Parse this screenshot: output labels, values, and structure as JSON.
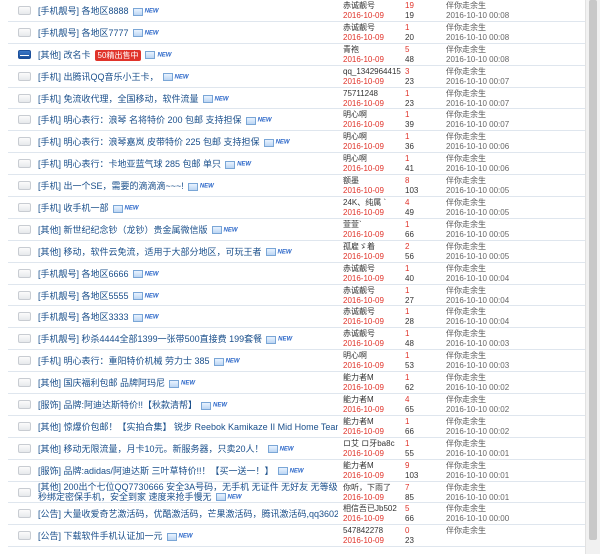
{
  "rows": [
    {
      "cat": "[手机靓号]",
      "title": "各地区8888",
      "new": "NEW",
      "author": "赤诚靓号",
      "date": "2016-10-09",
      "r": "19",
      "v": "19",
      "lu": "伴你走余生",
      "lt": "2016-10-10 00:08"
    },
    {
      "cat": "[手机靓号]",
      "title": "各地区7777",
      "new": "NEW",
      "author": "赤诚靓号",
      "date": "2016-10-09",
      "r": "1",
      "v": "20",
      "lu": "伴你走余生",
      "lt": "2016-10-10 00:08"
    },
    {
      "cat": "[其他]",
      "title": "改名卡",
      "badge": "50精出售中",
      "new": "NEW",
      "author": "青袍",
      "date": "2016-10-09",
      "r": "5",
      "v": "48",
      "lu": "伴你走余生",
      "lt": "2016-10-10 00:08"
    },
    {
      "cat": "[手机]",
      "title": "出腾讯QQ音乐小王卡，",
      "new": "NEW",
      "author": "qq_1342964415",
      "date": "2016-10-09",
      "r": "3",
      "v": "23",
      "lu": "伴你走余生",
      "lt": "2016-10-10 00:07"
    },
    {
      "cat": "[手机]",
      "title": "免流收代理，全国移动，软件流量",
      "new": "NEW",
      "author": "75711248",
      "date": "2016-10-09",
      "r": "1",
      "v": "23",
      "lu": "伴你走余生",
      "lt": "2016-10-10 00:07"
    },
    {
      "cat": "[手机]",
      "title": "明心表行：浪琴 名将特价  200 包邮 支持担保",
      "new": "NEW",
      "author": "明心啊",
      "date": "2016-10-09",
      "r": "1",
      "v": "39",
      "lu": "伴你走余生",
      "lt": "2016-10-10 00:07"
    },
    {
      "cat": "[手机]",
      "title": "明心表行：浪琴嘉岚 皮带特价  225 包邮 支持担保",
      "new": "NEW",
      "author": "明心啊",
      "date": "2016-10-09",
      "r": "1",
      "v": "36",
      "lu": "伴你走余生",
      "lt": "2016-10-10 00:06"
    },
    {
      "cat": "[手机]",
      "title": "明心表行：卡地亚蓝气球    285 包邮 单只",
      "new": "NEW",
      "author": "明心啊",
      "date": "2016-10-09",
      "r": "1",
      "v": "41",
      "lu": "伴你走余生",
      "lt": "2016-10-10 00:06"
    },
    {
      "cat": "[手机]",
      "title": "出一个SE，需要的滴滴滴~~~!",
      "new": "NEW",
      "author": "额墨",
      "date": "2016-10-09",
      "r": "8",
      "v": "103",
      "lu": "伴你走余生",
      "lt": "2016-10-10 00:05"
    },
    {
      "cat": "[手机]",
      "title": "收手机一部",
      "new": "NEW",
      "author": "24K、纯属 `",
      "date": "2016-10-09",
      "r": "4",
      "v": "49",
      "lu": "伴你走余生",
      "lt": "2016-10-10 00:05"
    },
    {
      "cat": "[其他]",
      "title": "新世纪纪念钞（龙钞）贵金属微信版",
      "new": "NEW",
      "author": "萱萱`",
      "date": "2016-10-09",
      "r": "1",
      "v": "66",
      "lu": "伴你走余生",
      "lt": "2016-10-10 00:05"
    },
    {
      "cat": "[其他]",
      "title": "移动，软件云免流，适用于大部分地区，可玩王者",
      "new": "NEW",
      "author": "孤雇ゞ着",
      "date": "2016-10-09",
      "r": "2",
      "v": "56",
      "lu": "伴你走余生",
      "lt": "2016-10-10 00:05"
    },
    {
      "cat": "[手机靓号]",
      "title": "各地区6666",
      "new": "NEW",
      "author": "赤诚靓号",
      "date": "2016-10-09",
      "r": "1",
      "v": "40",
      "lu": "伴你走余生",
      "lt": "2016-10-10 00:04"
    },
    {
      "cat": "[手机靓号]",
      "title": "各地区5555",
      "new": "NEW",
      "author": "赤诚靓号",
      "date": "2016-10-09",
      "r": "1",
      "v": "27",
      "lu": "伴你走余生",
      "lt": "2016-10-10 00:04"
    },
    {
      "cat": "[手机靓号]",
      "title": "各地区3333",
      "new": "NEW",
      "author": "赤诚靓号",
      "date": "2016-10-09",
      "r": "1",
      "v": "28",
      "lu": "伴你走余生",
      "lt": "2016-10-10 00:04"
    },
    {
      "cat": "[手机靓号]",
      "title": "秒杀4444全部1399一张带500直接费 199套餐",
      "new": "NEW",
      "author": "赤诚靓号",
      "date": "2016-10-09",
      "r": "1",
      "v": "48",
      "lu": "伴你走余生",
      "lt": "2016-10-10 00:03"
    },
    {
      "cat": "[手机]",
      "title": "明心表行：重阳特价机械 劳力士  385",
      "new": "NEW",
      "author": "明心啊",
      "date": "2016-10-09",
      "r": "1",
      "v": "53",
      "lu": "伴你走余生",
      "lt": "2016-10-10 00:03"
    },
    {
      "cat": "[其他]",
      "title": "国庆福利包邮 品牌阿玛尼",
      "new": "NEW",
      "author": "能力者M",
      "date": "2016-10-09",
      "r": "1",
      "v": "62",
      "lu": "伴你走余生",
      "lt": "2016-10-10 00:02"
    },
    {
      "cat": "[服饰]",
      "title": "品牌:阿迪达斯特价!!【秋款清帮】",
      "new": "NEW",
      "author": "能力者M",
      "date": "2016-10-09",
      "r": "4",
      "v": "65",
      "lu": "伴你走余生",
      "lt": "2016-10-10 00:02"
    },
    {
      "cat": "[其他]",
      "title": "惊爆价包邮！【实拍合集】 锐步 Reebok Kamikaze II Mid  Home Team",
      "new": "NEW",
      "author": "能力者M",
      "date": "2016-10-09",
      "r": "1",
      "v": "66",
      "lu": "伴你走余生",
      "lt": "2016-10-10 00:02"
    },
    {
      "cat": "[其他]",
      "title": "移动无限流量，月卡10元。新服务器，只卖20人！",
      "new": "NEW",
      "author": "ロ艾  ロ牙ba8c",
      "date": "2016-10-09",
      "r": "1",
      "v": "55",
      "lu": "伴你走余生",
      "lt": "2016-10-10 00:01"
    },
    {
      "cat": "[服饰]",
      "title": "品牌:adidas/阿迪达斯 三叶草特价!!！【买一送一！】",
      "new": "NEW",
      "author": "能力者M",
      "date": "2016-10-09",
      "r": "9",
      "v": "103",
      "lu": "伴你走余生",
      "lt": "2016-10-10 00:01"
    },
    {
      "cat": "[其他]",
      "title": "200出个七位QQ7730666 安全3A号码，无手机 无证件 无好友 无等级 秒绑定密保手机，安全到家 速度来抢手慢无",
      "new": "NEW",
      "author": "你听，下雨了",
      "date": "2016-10-09",
      "r": "7",
      "v": "85",
      "lu": "伴你走余生",
      "lt": "2016-10-10 00:01"
    },
    {
      "cat": "[公告]",
      "title": "大量收爱奇艺激活码，优酷激活码，芒果激活码，腾讯激活码,qq360251227",
      "new": "NEW",
      "author": "相信吾已Jb502",
      "date": "2016-10-09",
      "r": "5",
      "v": "66",
      "lu": "伴你走余生",
      "lt": "2016-10-10 00:00"
    },
    {
      "cat": "[公告]",
      "title": "下载软件手机认证加一元",
      "new": "NEW",
      "author": "547842278",
      "date": "2016-10-09",
      "r": "0",
      "v": "23",
      "lu": "伴你走余生",
      "lt": ""
    }
  ]
}
